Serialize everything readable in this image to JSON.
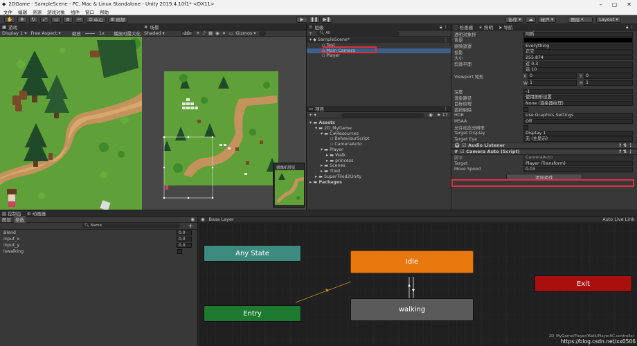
{
  "app": {
    "title": "2DGame - SampleScene - PC, Mac & Linux Standalone - Unity 2019.4.10f1* <DX11>",
    "menu": [
      "文件",
      "编辑",
      "资源",
      "游戏对象",
      "组件",
      "窗口",
      "帮助"
    ]
  },
  "toolbar": {
    "center_label": "中心",
    "local_label": "局部",
    "collab": "协作",
    "account": "帐户",
    "layers": "图层",
    "layout": "Layout"
  },
  "game_view": {
    "tab": "游戏",
    "display": "Display 1",
    "aspect": "Free Aspect",
    "scale_label": "缩放",
    "scale_value": "1x",
    "maximize": "播放时最大化"
  },
  "scene_view": {
    "tab": "场景",
    "shading": "Shaded",
    "mode_2d": "2D",
    "gizmos": "Gizmos",
    "search_placeholder": "All",
    "camera_preview_label": "摄像机预览"
  },
  "hierarchy": {
    "tab": "层级",
    "search_placeholder": "All",
    "add_button": "+",
    "scene": "SampleScene*",
    "items": [
      "Test",
      "Main Camera",
      "Player"
    ]
  },
  "project": {
    "tab": "项目",
    "badge": "17",
    "tree": [
      "Assets",
      "2D_MyGame",
      "C#Resources",
      "BehaviourScript",
      "CameraAuto",
      "Player",
      "Walk",
      "princess",
      "Scenes",
      "Tiled",
      "SuperTiled2Unity",
      "Packages"
    ]
  },
  "inspector": {
    "tabs": [
      "检查器",
      "照明",
      "导航"
    ],
    "rows_top": [
      {
        "k": "透明对象排",
        "v": "阿斯"
      },
      {
        "k": "背景",
        "v": ""
      },
      {
        "k": "剔除遮罩",
        "v": "Everything"
      },
      {
        "k": "投影",
        "v": "正交"
      },
      {
        "k": "大小",
        "v": "255.874"
      },
      {
        "k": "剪裁平面",
        "v": "近  0.3"
      },
      {
        "k": "",
        "v": "远  10"
      }
    ],
    "viewport_label": "Viewport 矩形",
    "viewport": {
      "x_label": "X",
      "x": "0",
      "y_label": "Y",
      "y": "0",
      "w_label": "W",
      "w": "1",
      "h_label": "H",
      "h": "1"
    },
    "rows_mid": [
      {
        "k": "深度",
        "v": "-1"
      },
      {
        "k": "渲染路径",
        "v": "使用图形设置"
      },
      {
        "k": "目标纹理",
        "v": "None (渲染器纹理)"
      },
      {
        "k": "遮挡剔除",
        "v": ""
      },
      {
        "k": "HDR",
        "v": "Use Graphics Settings"
      },
      {
        "k": "MSAA",
        "v": "Off"
      },
      {
        "k": "允许动态分辨率",
        "v": ""
      },
      {
        "k": "Target Display",
        "v": "Display 1"
      },
      {
        "k": "Target Eye",
        "v": "无 (主显示)"
      }
    ],
    "audio_listener": "Audio Listener",
    "camera_auto": "Camera Auto (Script)",
    "script_label": "脚本",
    "script_value": "CameraAuto",
    "target_label": "Target",
    "target_value": "Player (Transform)",
    "move_speed_label": "Move Speed",
    "move_speed_value": "0.03",
    "add_component": "添加组件"
  },
  "animator": {
    "tabs": [
      "控制台",
      "动画器"
    ],
    "sub_tabs": [
      "图层",
      "参数"
    ],
    "search_placeholder": "Name",
    "add_button": "+",
    "breadcrumb": "Base Layer",
    "auto_live": "Auto Live Link",
    "parameters": [
      {
        "name": "Blend",
        "value": "0.0"
      },
      {
        "name": "input_x",
        "value": "0.0"
      },
      {
        "name": "input_y",
        "value": "0.0"
      },
      {
        "name": "iswalking",
        "value": ""
      }
    ],
    "states": {
      "any": "Any State",
      "entry": "Entry",
      "idle": "Idle",
      "walking": "walking",
      "exit": "Exit"
    },
    "footer_path": "2D_MyGame/Player/Walk/PlayerAC.controller"
  },
  "watermark": "https://blog.csdn.net/xx0506",
  "colors": {
    "highlight": "#e03040",
    "idle": "#e8780d",
    "entry": "#1e7a2e",
    "any": "#3d8a80",
    "exit": "#a81010"
  }
}
